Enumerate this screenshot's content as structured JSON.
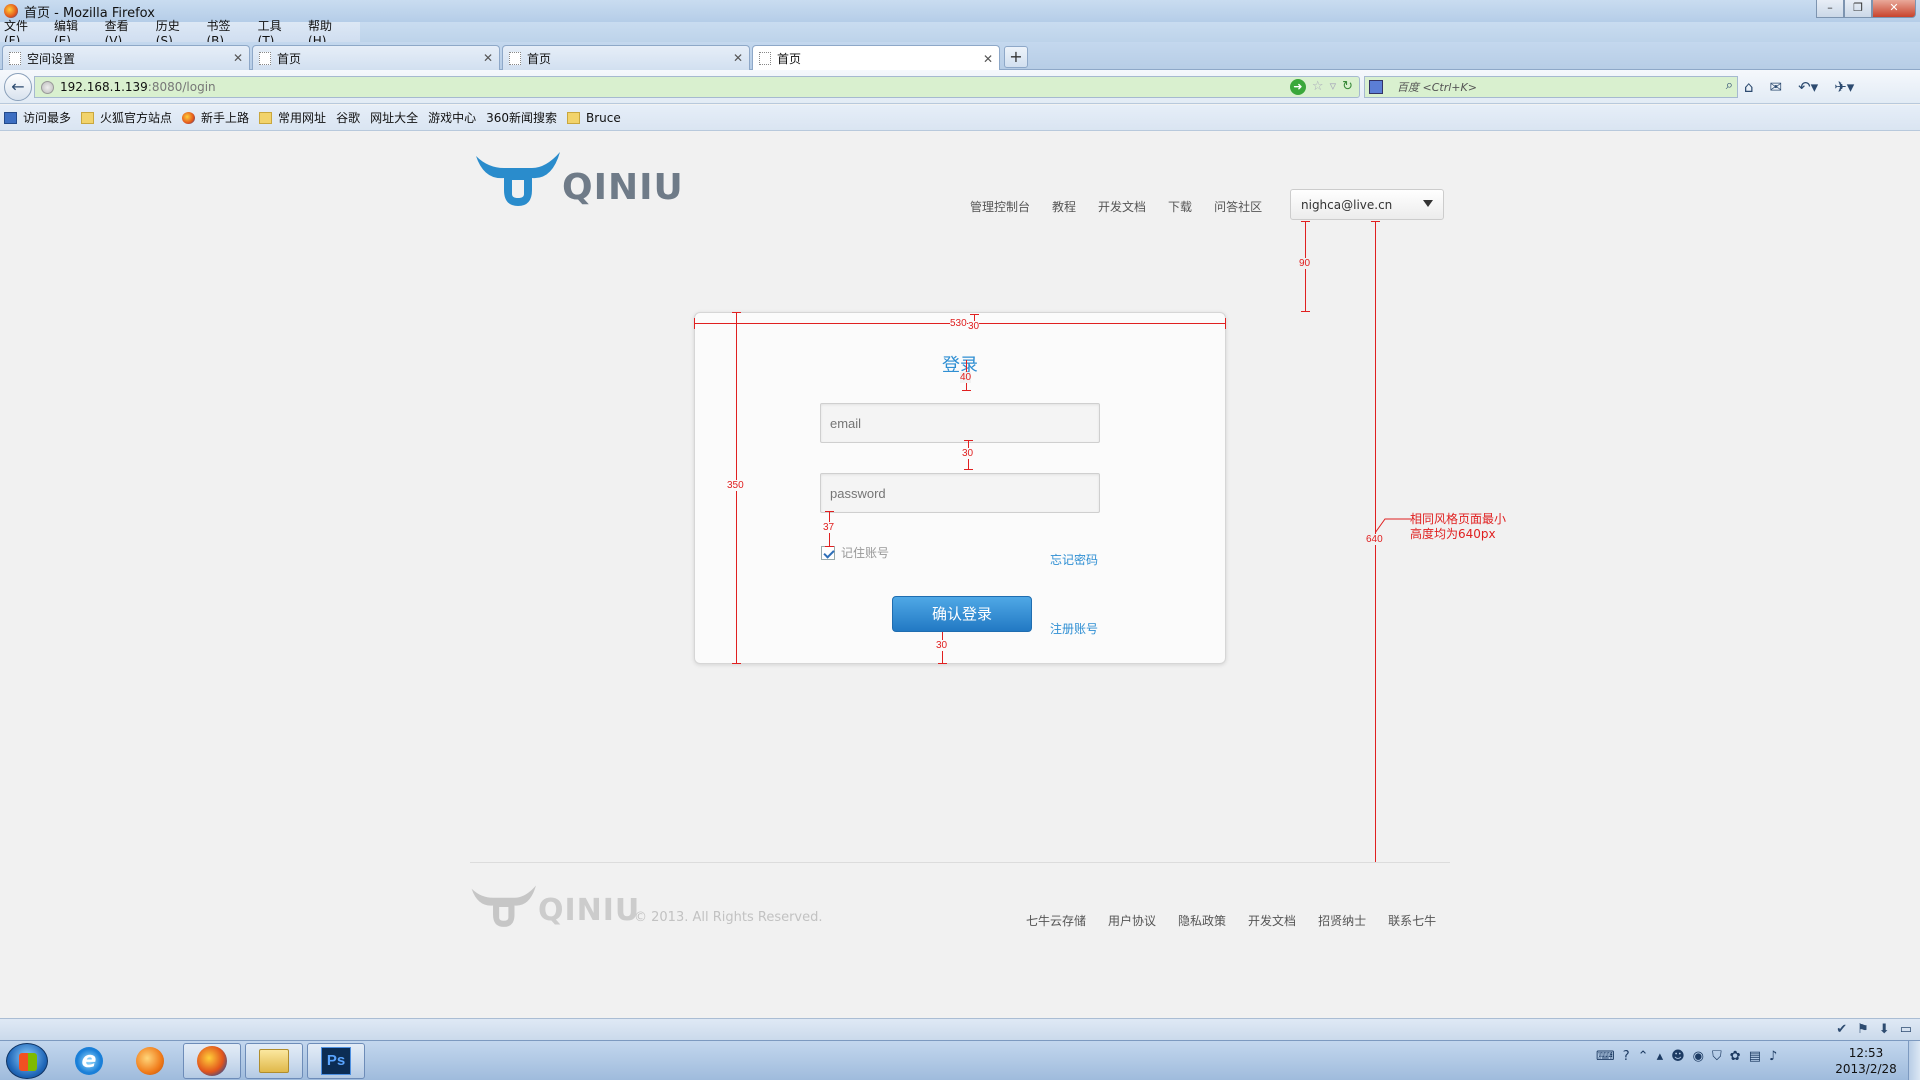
{
  "window": {
    "title": "首页 - Mozilla Firefox"
  },
  "menu": [
    "文件(F)",
    "编辑(E)",
    "查看(V)",
    "历史(S)",
    "书签(B)",
    "工具(T)",
    "帮助(H)"
  ],
  "tabs": [
    {
      "label": "空间设置"
    },
    {
      "label": "首页"
    },
    {
      "label": "首页"
    },
    {
      "label": "首页"
    }
  ],
  "nav": {
    "url_host": "192.168.1.139",
    "url_path": ":8080/login",
    "search_placeholder": "百度 <Ctrl+K>"
  },
  "bookmarks": [
    {
      "label": "访问最多",
      "icon": "most-visited-icon"
    },
    {
      "label": "火狐官方站点",
      "icon": "folder-icon"
    },
    {
      "label": "新手上路",
      "icon": "firefox-icon"
    },
    {
      "label": "常用网址",
      "icon": "folder-icon"
    },
    {
      "label": "谷歌",
      "icon": "page-icon"
    },
    {
      "label": "网址大全",
      "icon": "page-icon"
    },
    {
      "label": "游戏中心",
      "icon": "page-icon"
    },
    {
      "label": "360新闻搜索",
      "icon": "page-icon"
    },
    {
      "label": "Bruce",
      "icon": "folder-icon"
    }
  ],
  "site": {
    "logo_text": "QINIU",
    "topnav": [
      "管理控制台",
      "教程",
      "开发文档",
      "下载",
      "问答社区"
    ],
    "user_email": "nighca@live.cn"
  },
  "login": {
    "title": "登录",
    "email_placeholder": "email",
    "password_placeholder": "password",
    "remember_label": "记住账号",
    "remember_checked": true,
    "forgot_link": "忘记密码",
    "submit_label": "确认登录",
    "register_link": "注册账号"
  },
  "annotations": {
    "card_width": "530",
    "top_pad": "30",
    "title_gap": "40",
    "field_gap": "30",
    "pw_check_gap": "37",
    "bottom_pad": "30",
    "card_height": "350",
    "header_gap": "90",
    "page_height": "640",
    "note_line1": "相同风格页面最小",
    "note_line2": "高度均为640px",
    "color": "#e02020"
  },
  "footer": {
    "logo_text": "QINIU",
    "copyright": "© 2013. All Rights Reserved.",
    "links": [
      "七牛云存储",
      "用户协议",
      "隐私政策",
      "开发文档",
      "招贤纳士",
      "联系七牛"
    ]
  },
  "taskbar": {
    "apps": [
      "internet-explorer-icon",
      "music-player-icon",
      "firefox-icon",
      "file-explorer-icon",
      "photoshop-icon"
    ],
    "ps_label": "Ps",
    "time": "12:53",
    "date": "2013/2/28"
  }
}
